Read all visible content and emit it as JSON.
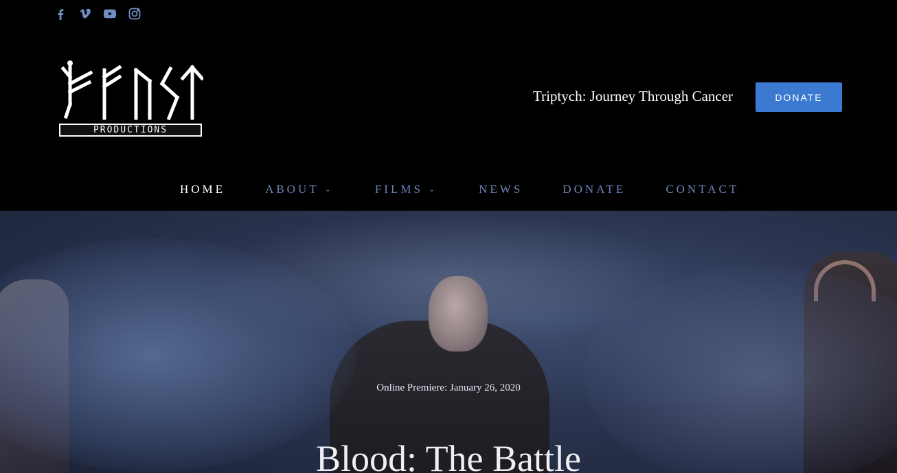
{
  "social": {
    "icons": [
      "facebook-icon",
      "vimeo-icon",
      "youtube-icon",
      "instagram-icon"
    ]
  },
  "logo": {
    "title": "FEAST",
    "subtitle": "PRODUCTIONS"
  },
  "header": {
    "tagline": "Triptych: Journey Through Cancer",
    "donate_label": "DONATE"
  },
  "nav": {
    "items": [
      {
        "label": "HOME",
        "active": true
      },
      {
        "label": "ABOUT",
        "has_dropdown": true
      },
      {
        "label": "FILMS",
        "has_dropdown": true
      },
      {
        "label": "NEWS"
      },
      {
        "label": "DONATE"
      },
      {
        "label": "CONTACT"
      }
    ]
  },
  "hero": {
    "subtitle": "Online Premiere: January 26, 2020",
    "title": "Blood: The Battle"
  },
  "colors": {
    "background": "#000000",
    "accent": "#3b7ad0",
    "nav_text": "#6a84b8",
    "social_icon": "#6f8fc0"
  }
}
